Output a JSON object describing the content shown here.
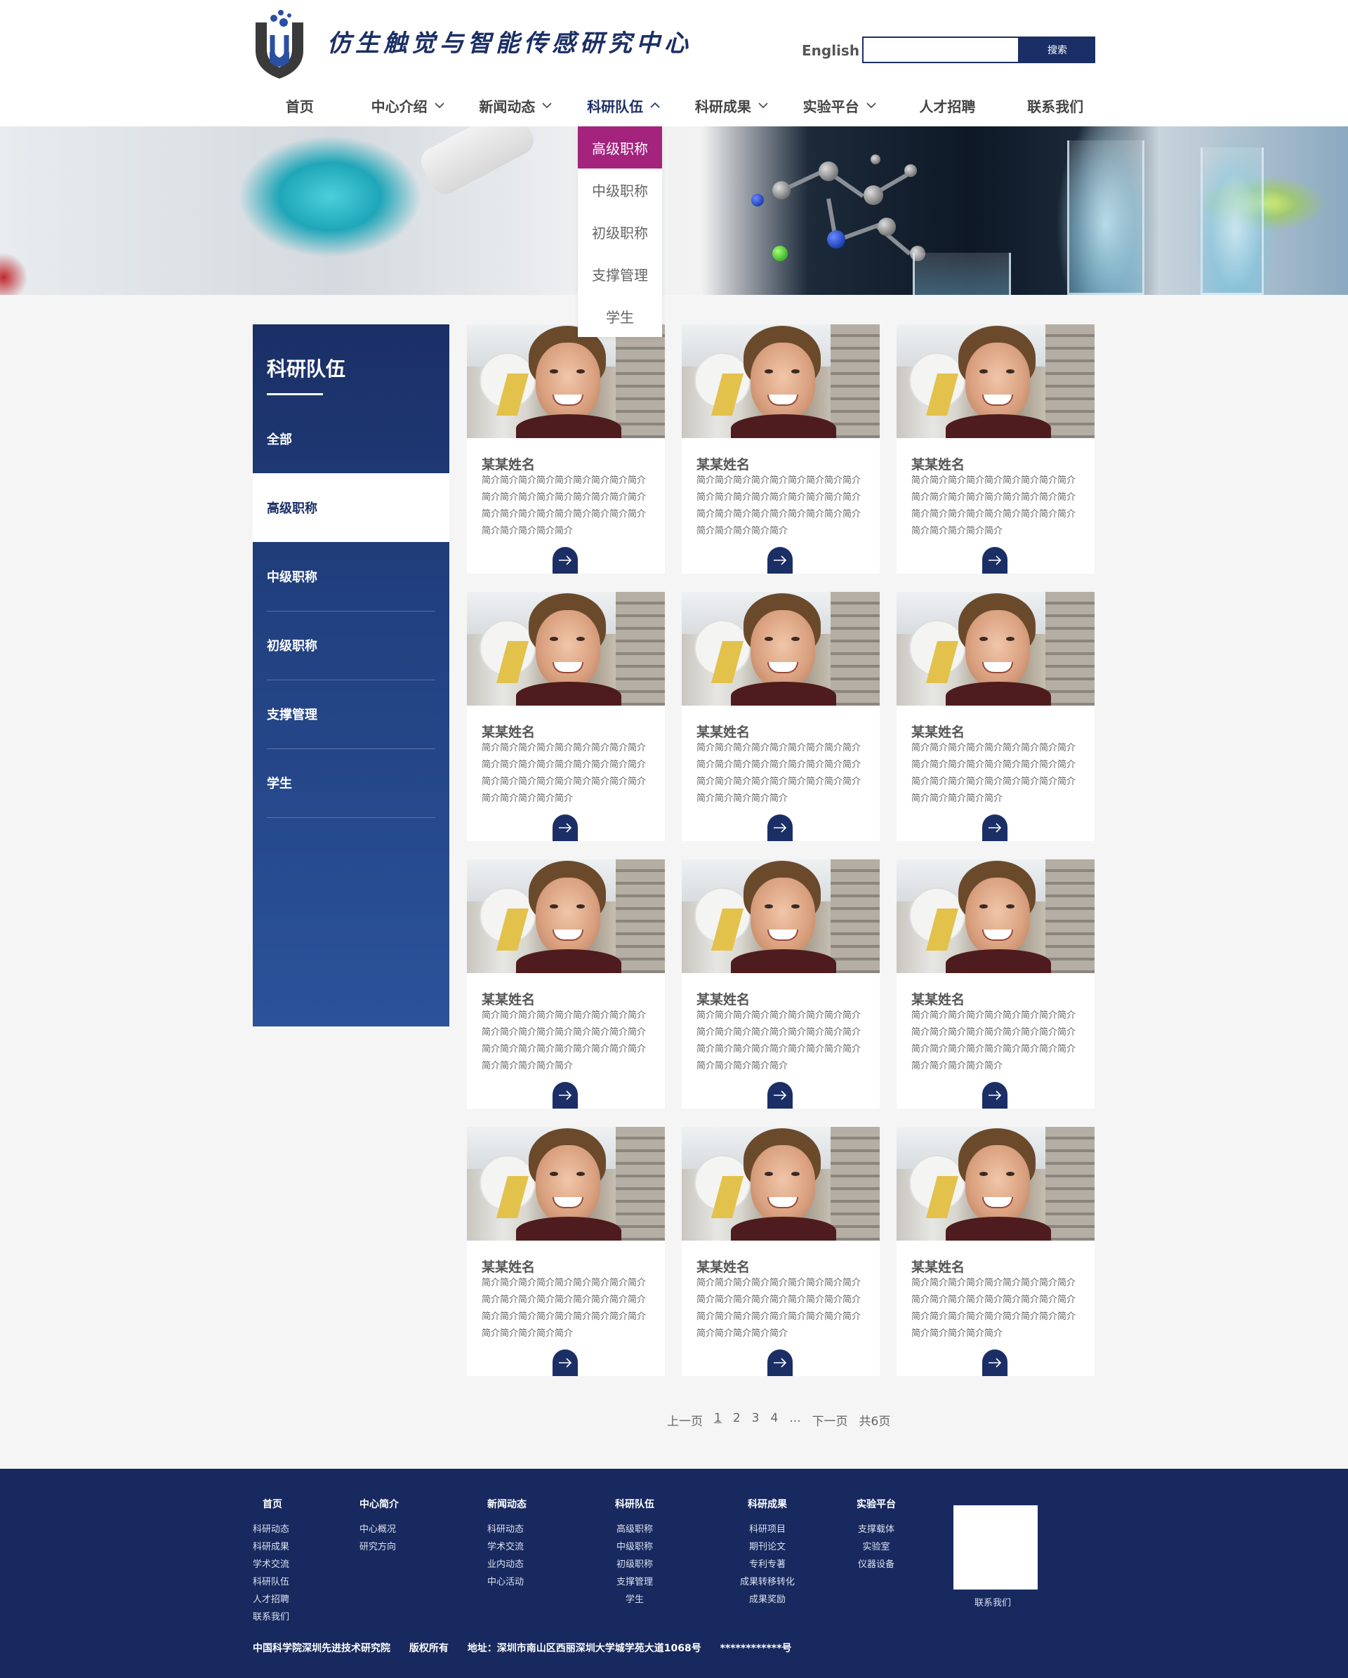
{
  "header": {
    "site_title": "仿生触觉与智能传感研究中心",
    "lang_link": "English",
    "search_placeholder": "",
    "search_button": "搜索",
    "brand_color": "#1b2f66"
  },
  "nav": [
    {
      "label": "首页",
      "has_dropdown": false
    },
    {
      "label": "中心介绍",
      "has_dropdown": true
    },
    {
      "label": "新闻动态",
      "has_dropdown": true
    },
    {
      "label": "科研队伍",
      "has_dropdown": true,
      "expanded": true
    },
    {
      "label": "科研成果",
      "has_dropdown": true
    },
    {
      "label": "实验平台",
      "has_dropdown": true
    },
    {
      "label": "人才招聘",
      "has_dropdown": false
    },
    {
      "label": "联系我们",
      "has_dropdown": false
    }
  ],
  "dropdown": {
    "accent": "#a3237d",
    "items": [
      "高级职称",
      "中级职称",
      "初级职称",
      "支撑管理",
      "学生"
    ],
    "selected": "高级职称"
  },
  "sidebar": {
    "title": "科研队伍",
    "items": [
      "全部",
      "高级职称",
      "中级职称",
      "初级职称",
      "支撑管理",
      "学生"
    ],
    "selected": "高级职称"
  },
  "cards": [
    {
      "name": "某某姓名",
      "desc": "简介简介简介简介简介简介简介简介简介简介简介简介简介简介简介简介简介简介简介简介简介简介简介简介简介简介简介简介简介简介简介简介"
    },
    {
      "name": "某某姓名",
      "desc": "简介简介简介简介简介简介简介简介简介简介简介简介简介简介简介简介简介简介简介简介简介简介简介简介简介简介简介简介简介简介简介简介"
    },
    {
      "name": "某某姓名",
      "desc": "简介简介简介简介简介简介简介简介简介简介简介简介简介简介简介简介简介简介简介简介简介简介简介简介简介简介简介简介简介简介简介简介"
    },
    {
      "name": "某某姓名",
      "desc": "简介简介简介简介简介简介简介简介简介简介简介简介简介简介简介简介简介简介简介简介简介简介简介简介简介简介简介简介简介简介简介简介"
    },
    {
      "name": "某某姓名",
      "desc": "简介简介简介简介简介简介简介简介简介简介简介简介简介简介简介简介简介简介简介简介简介简介简介简介简介简介简介简介简介简介简介简介"
    },
    {
      "name": "某某姓名",
      "desc": "简介简介简介简介简介简介简介简介简介简介简介简介简介简介简介简介简介简介简介简介简介简介简介简介简介简介简介简介简介简介简介简介"
    },
    {
      "name": "某某姓名",
      "desc": "简介简介简介简介简介简介简介简介简介简介简介简介简介简介简介简介简介简介简介简介简介简介简介简介简介简介简介简介简介简介简介简介"
    },
    {
      "name": "某某姓名",
      "desc": "简介简介简介简介简介简介简介简介简介简介简介简介简介简介简介简介简介简介简介简介简介简介简介简介简介简介简介简介简介简介简介简介"
    },
    {
      "name": "某某姓名",
      "desc": "简介简介简介简介简介简介简介简介简介简介简介简介简介简介简介简介简介简介简介简介简介简介简介简介简介简介简介简介简介简介简介简介"
    },
    {
      "name": "某某姓名",
      "desc": "简介简介简介简介简介简介简介简介简介简介简介简介简介简介简介简介简介简介简介简介简介简介简介简介简介简介简介简介简介简介简介简介"
    },
    {
      "name": "某某姓名",
      "desc": "简介简介简介简介简介简介简介简介简介简介简介简介简介简介简介简介简介简介简介简介简介简介简介简介简介简介简介简介简介简介简介简介"
    },
    {
      "name": "某某姓名",
      "desc": "简介简介简介简介简介简介简介简介简介简介简介简介简介简介简介简介简介简介简介简介简介简介简介简介简介简介简介简介简介简介简介简介"
    }
  ],
  "pagination": {
    "prev": "上一页",
    "pages": [
      "1",
      "2",
      "3",
      "4"
    ],
    "current": "1",
    "ellipsis": "...",
    "next": "下一页",
    "total": "共6页"
  },
  "footer": {
    "columns": [
      {
        "title": "首页",
        "links": [
          "科研动态",
          "科研成果",
          "学术交流",
          "科研队伍",
          "人才招聘",
          "联系我们"
        ]
      },
      {
        "title": "中心简介",
        "links": [
          "中心概况",
          "研究方向"
        ]
      },
      {
        "title": "新闻动态",
        "links": [
          "科研动态",
          "学术交流",
          "业内动态",
          "中心活动"
        ]
      },
      {
        "title": "科研队伍",
        "links": [
          "高级职称",
          "中级职称",
          "初级职称",
          "支撑管理",
          "学生"
        ]
      },
      {
        "title": "科研成果",
        "links": [
          "科研项目",
          "期刊论文",
          "专利专著",
          "成果转移转化",
          "成果奖励"
        ]
      },
      {
        "title": "实验平台",
        "links": [
          "支撑载体",
          "实验室",
          "仪器设备"
        ]
      }
    ],
    "qr_label": "联系我们",
    "org": "中国科学院深圳先进技术研究院",
    "rights": "版权所有",
    "address": "地址：深圳市南山区西丽深圳大学城学苑大道1068号",
    "icp": "************号",
    "bg_color": "#17295e"
  }
}
